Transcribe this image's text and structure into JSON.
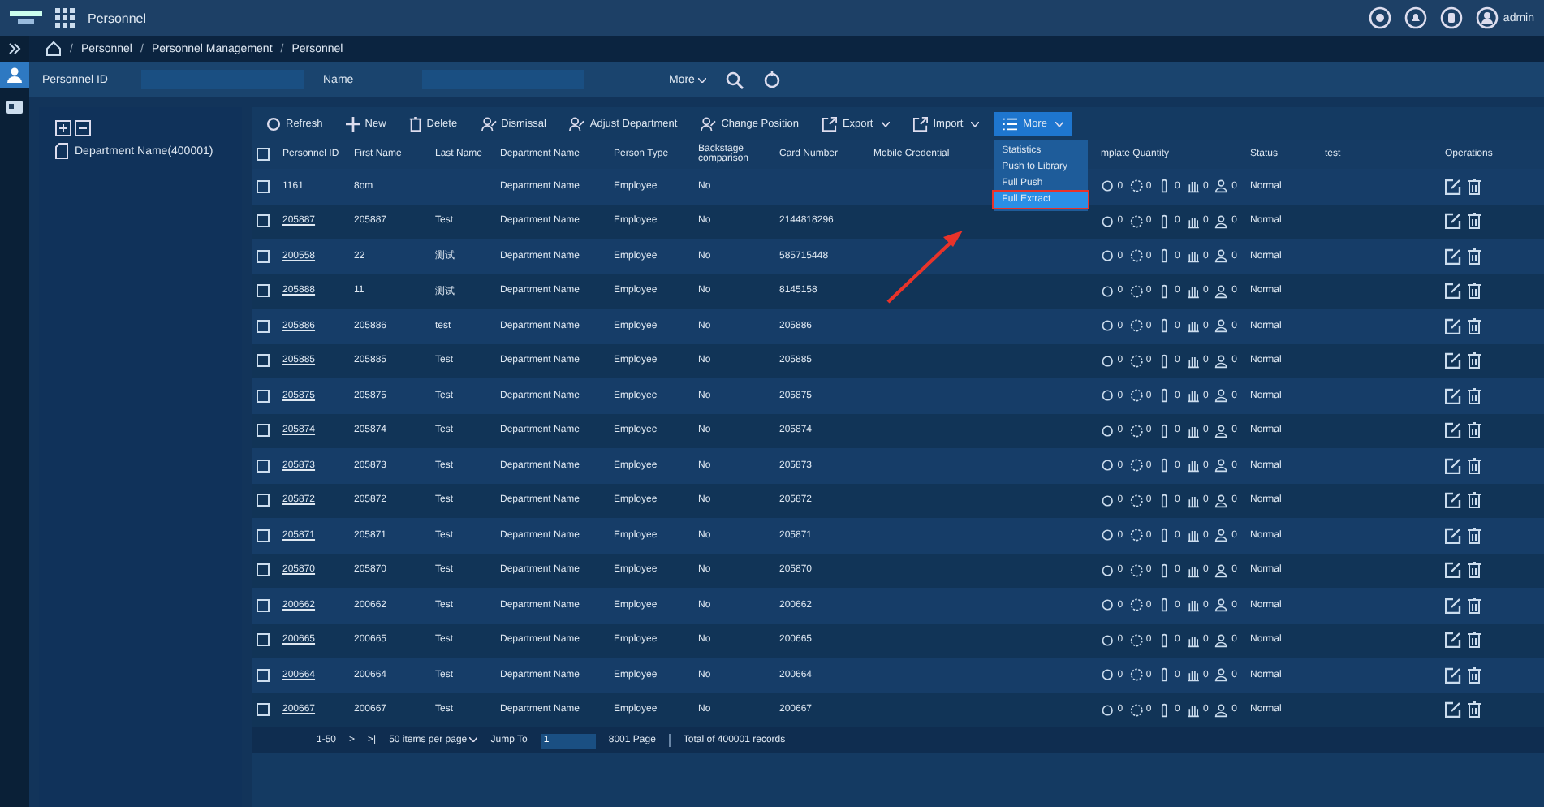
{
  "app_title": "Personnel",
  "user": "admin",
  "breadcrumb": [
    {
      "separator": "/",
      "label": "Personnel"
    },
    {
      "separator": "/",
      "label": "Personnel Management"
    },
    {
      "separator": "/",
      "label": "Personnel"
    }
  ],
  "select_all_checked": false,
  "search": [
    {
      "label": "Personnel ID"
    },
    {
      "label": "Name"
    }
  ],
  "more_filter": "More",
  "tree": {
    "root": "Department Name(400001)"
  },
  "toolbar": [
    {
      "label": "Refresh",
      "kind": "refresh",
      "dropdown": false,
      "selected": false
    },
    {
      "label": "New",
      "kind": "plus",
      "dropdown": false,
      "selected": false
    },
    {
      "label": "Delete",
      "kind": "trash",
      "dropdown": false,
      "selected": false
    },
    {
      "label": "Dismissal",
      "kind": "person",
      "dropdown": false,
      "selected": false
    },
    {
      "label": "Adjust Department",
      "kind": "person",
      "dropdown": false,
      "selected": false
    },
    {
      "label": "Change Position",
      "kind": "person",
      "dropdown": false,
      "selected": false
    },
    {
      "label": "Export",
      "kind": "export",
      "dropdown": true,
      "selected": false
    },
    {
      "label": "Import",
      "kind": "export",
      "dropdown": true,
      "selected": false
    },
    {
      "label": "More",
      "kind": "list",
      "dropdown": true,
      "selected": true
    }
  ],
  "more_menu": [
    {
      "label": "Statistics",
      "selected": false
    },
    {
      "label": "Push to Library",
      "selected": false
    },
    {
      "label": "Full Push",
      "selected": false
    },
    {
      "label": "Full Extract",
      "selected": true
    }
  ],
  "columns": [
    "Personnel ID",
    "First Name",
    "Last Name",
    "Department Name",
    "Person Type",
    "Backstage comparison",
    "Card Number",
    "Mobile Credential",
    "mplate Quantity",
    "Status",
    "test",
    "Operations"
  ],
  "rows": [
    {
      "id": "1161",
      "link": false,
      "first": "8om",
      "last": "",
      "dept": "Department Name",
      "type": "Employee",
      "backstage": "No",
      "card": "",
      "templates": [
        "0",
        "0",
        "0",
        "0",
        "0"
      ],
      "status": "Normal",
      "checked": false
    },
    {
      "id": "205887",
      "link": true,
      "first": "205887",
      "last": "Test",
      "dept": "Department Name",
      "type": "Employee",
      "backstage": "No",
      "card": "2144818296",
      "templates": [
        "0",
        "0",
        "0",
        "0",
        "0"
      ],
      "status": "Normal",
      "checked": false
    },
    {
      "id": "200558",
      "link": true,
      "first": "22",
      "last": "测试",
      "dept": "Department Name",
      "type": "Employee",
      "backstage": "No",
      "card": "585715448",
      "templates": [
        "0",
        "0",
        "0",
        "0",
        "0"
      ],
      "status": "Normal",
      "checked": false
    },
    {
      "id": "205888",
      "link": true,
      "first": "11",
      "last": "测试",
      "dept": "Department Name",
      "type": "Employee",
      "backstage": "No",
      "card": "8145158",
      "templates": [
        "0",
        "0",
        "0",
        "0",
        "0"
      ],
      "status": "Normal",
      "checked": false
    },
    {
      "id": "205886",
      "link": true,
      "first": "205886",
      "last": "test",
      "dept": "Department Name",
      "type": "Employee",
      "backstage": "No",
      "card": "205886",
      "templates": [
        "0",
        "0",
        "0",
        "0",
        "0"
      ],
      "status": "Normal",
      "checked": false
    },
    {
      "id": "205885",
      "link": true,
      "first": "205885",
      "last": "Test",
      "dept": "Department Name",
      "type": "Employee",
      "backstage": "No",
      "card": "205885",
      "templates": [
        "0",
        "0",
        "0",
        "0",
        "0"
      ],
      "status": "Normal",
      "checked": false
    },
    {
      "id": "205875",
      "link": true,
      "first": "205875",
      "last": "Test",
      "dept": "Department Name",
      "type": "Employee",
      "backstage": "No",
      "card": "205875",
      "templates": [
        "0",
        "0",
        "0",
        "0",
        "0"
      ],
      "status": "Normal",
      "checked": false
    },
    {
      "id": "205874",
      "link": true,
      "first": "205874",
      "last": "Test",
      "dept": "Department Name",
      "type": "Employee",
      "backstage": "No",
      "card": "205874",
      "templates": [
        "0",
        "0",
        "0",
        "0",
        "0"
      ],
      "status": "Normal",
      "checked": false
    },
    {
      "id": "205873",
      "link": true,
      "first": "205873",
      "last": "Test",
      "dept": "Department Name",
      "type": "Employee",
      "backstage": "No",
      "card": "205873",
      "templates": [
        "0",
        "0",
        "0",
        "0",
        "0"
      ],
      "status": "Normal",
      "checked": false
    },
    {
      "id": "205872",
      "link": true,
      "first": "205872",
      "last": "Test",
      "dept": "Department Name",
      "type": "Employee",
      "backstage": "No",
      "card": "205872",
      "templates": [
        "0",
        "0",
        "0",
        "0",
        "0"
      ],
      "status": "Normal",
      "checked": false
    },
    {
      "id": "205871",
      "link": true,
      "first": "205871",
      "last": "Test",
      "dept": "Department Name",
      "type": "Employee",
      "backstage": "No",
      "card": "205871",
      "templates": [
        "0",
        "0",
        "0",
        "0",
        "0"
      ],
      "status": "Normal",
      "checked": false
    },
    {
      "id": "205870",
      "link": true,
      "first": "205870",
      "last": "Test",
      "dept": "Department Name",
      "type": "Employee",
      "backstage": "No",
      "card": "205870",
      "templates": [
        "0",
        "0",
        "0",
        "0",
        "0"
      ],
      "status": "Normal",
      "checked": false
    },
    {
      "id": "200662",
      "link": true,
      "first": "200662",
      "last": "Test",
      "dept": "Department Name",
      "type": "Employee",
      "backstage": "No",
      "card": "200662",
      "templates": [
        "0",
        "0",
        "0",
        "0",
        "0"
      ],
      "status": "Normal",
      "checked": false
    },
    {
      "id": "200665",
      "link": true,
      "first": "200665",
      "last": "Test",
      "dept": "Department Name",
      "type": "Employee",
      "backstage": "No",
      "card": "200665",
      "templates": [
        "0",
        "0",
        "0",
        "0",
        "0"
      ],
      "status": "Normal",
      "checked": false
    },
    {
      "id": "200664",
      "link": true,
      "first": "200664",
      "last": "Test",
      "dept": "Department Name",
      "type": "Employee",
      "backstage": "No",
      "card": "200664",
      "templates": [
        "0",
        "0",
        "0",
        "0",
        "0"
      ],
      "status": "Normal",
      "checked": false
    },
    {
      "id": "200667",
      "link": true,
      "first": "200667",
      "last": "Test",
      "dept": "Department Name",
      "type": "Employee",
      "backstage": "No",
      "card": "200667",
      "templates": [
        "0",
        "0",
        "0",
        "0",
        "0"
      ],
      "status": "Normal",
      "checked": false
    }
  ],
  "pagination": {
    "range": "1-50",
    "next": ">",
    "last": ">|",
    "per_page": "50 items per page",
    "jump_label": "Jump To",
    "page": "1",
    "pages": "8001 Page",
    "total": "Total of 400001 records"
  }
}
